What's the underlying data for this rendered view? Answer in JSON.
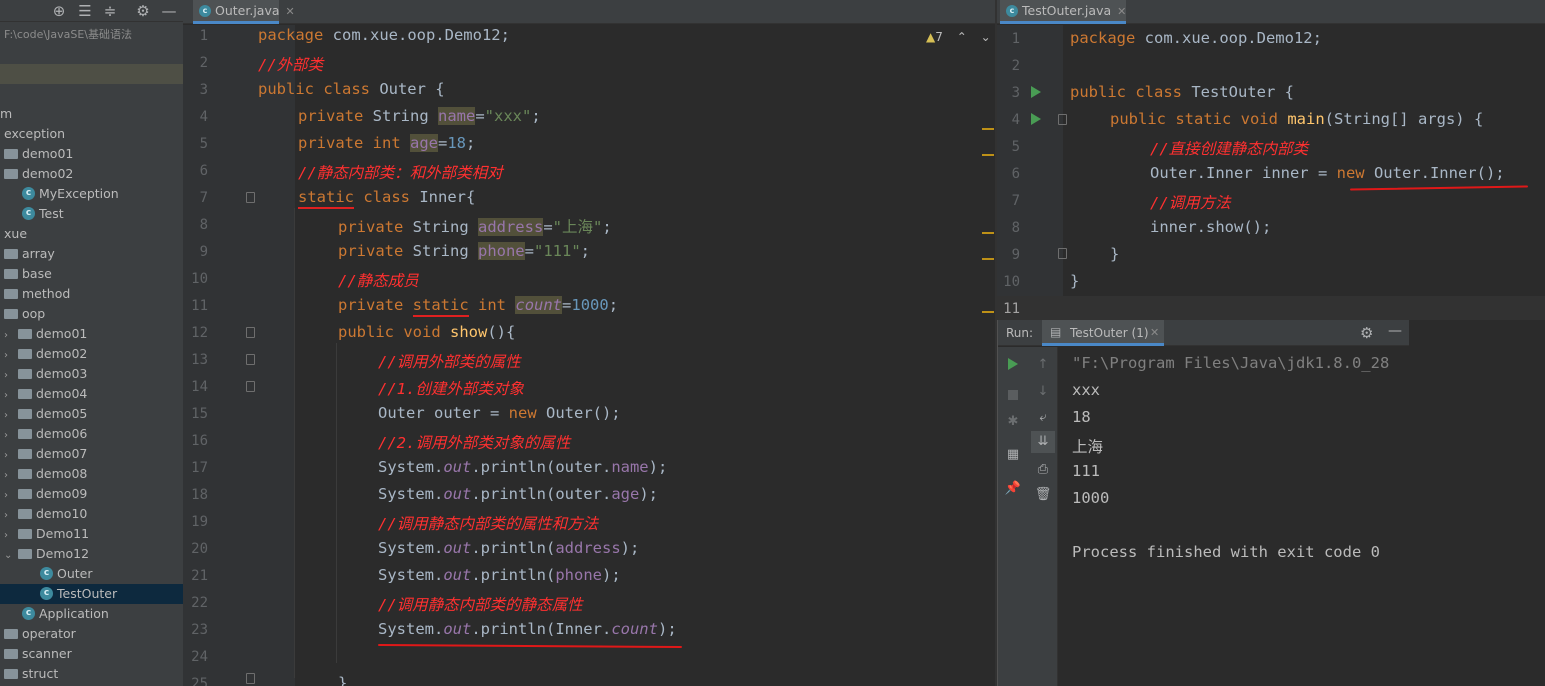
{
  "sidebar": {
    "path": "F:\\code\\JavaSE\\基础语法",
    "items": [
      {
        "label": "m",
        "type": "text"
      },
      {
        "label": "exception",
        "type": "text"
      },
      {
        "label": "demo01",
        "type": "folder"
      },
      {
        "label": "demo02",
        "type": "folder"
      },
      {
        "label": "MyException",
        "type": "class"
      },
      {
        "label": "Test",
        "type": "class"
      },
      {
        "label": "xue",
        "type": "text"
      },
      {
        "label": "array",
        "type": "folder"
      },
      {
        "label": "base",
        "type": "folder"
      },
      {
        "label": "method",
        "type": "folder"
      },
      {
        "label": "oop",
        "type": "folder"
      },
      {
        "label": "demo01",
        "type": "folder"
      },
      {
        "label": "demo02",
        "type": "folder"
      },
      {
        "label": "demo03",
        "type": "folder"
      },
      {
        "label": "demo04",
        "type": "folder"
      },
      {
        "label": "demo05",
        "type": "folder"
      },
      {
        "label": "demo06",
        "type": "folder"
      },
      {
        "label": "demo07",
        "type": "folder"
      },
      {
        "label": "demo08",
        "type": "folder"
      },
      {
        "label": "demo09",
        "type": "folder"
      },
      {
        "label": "demo10",
        "type": "folder"
      },
      {
        "label": "Demo11",
        "type": "folder"
      },
      {
        "label": "Demo12",
        "type": "folder"
      },
      {
        "label": "Outer",
        "type": "class"
      },
      {
        "label": "TestOuter",
        "type": "class"
      },
      {
        "label": "Application",
        "type": "class"
      },
      {
        "label": "operator",
        "type": "folder"
      },
      {
        "label": "scanner",
        "type": "folder"
      },
      {
        "label": "struct",
        "type": "folder"
      }
    ]
  },
  "left_editor": {
    "tab": "Outer.java",
    "warning_count": "7",
    "line_numbers": [
      "1",
      "2",
      "3",
      "4",
      "5",
      "6",
      "7",
      "8",
      "9",
      "10",
      "11",
      "12",
      "13",
      "14",
      "15",
      "16",
      "17",
      "18",
      "19",
      "20",
      "21",
      "22",
      "23",
      "24",
      "25"
    ]
  },
  "right_editor": {
    "tab": "TestOuter.java",
    "line_numbers": [
      "1",
      "2",
      "3",
      "4",
      "5",
      "6",
      "7",
      "8",
      "9",
      "10",
      "11"
    ]
  },
  "run_panel": {
    "label": "Run:",
    "tab": "TestOuter (1)",
    "output": [
      "\"F:\\Program Files\\Java\\jdk1.8.0_28",
      "xxx",
      "18",
      "上海",
      "111",
      "1000",
      "",
      "Process finished with exit code 0"
    ]
  },
  "colors": {
    "background": "#2b2b2b",
    "keyword": "#cc7832",
    "comment": "#ff3030",
    "string": "#6a8759",
    "number": "#6897bb",
    "field": "#9876aa",
    "method": "#ffc66d",
    "underline": "#e01818"
  }
}
